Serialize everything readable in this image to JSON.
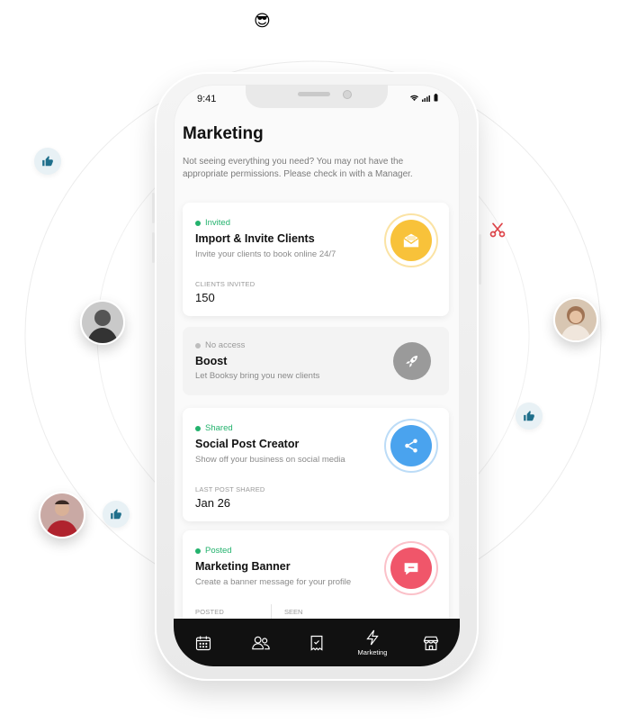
{
  "status_bar": {
    "time": "9:41"
  },
  "page": {
    "title": "Marketing",
    "subtitle": "Not seeing everything you need? You may not have the appropriate permissions. Please check in with a Manager."
  },
  "cards": [
    {
      "status": "Invited",
      "title": "Import & Invite Clients",
      "description": "Invite your clients to book online 24/7",
      "metric_label": "CLIENTS INVITED",
      "metric_value": "150",
      "icon": "envelope-icon",
      "color": "#f8c23a"
    },
    {
      "status": "No access",
      "title": "Boost",
      "description": "Let Booksy bring you new clients",
      "icon": "rocket-icon",
      "color": "#9a9a9a"
    },
    {
      "status": "Shared",
      "title": "Social Post Creator",
      "description": "Show off your business on social media",
      "metric_label": "LAST POST SHARED",
      "metric_value": "Jan 26",
      "icon": "share-icon",
      "color": "#4aa3ee"
    },
    {
      "status": "Posted",
      "title": "Marketing Banner",
      "description": "Create a banner message for your profile",
      "metric_label": "POSTED",
      "metric_label_2": "SEEN",
      "icon": "speech-bubble-icon",
      "color": "#f0566a"
    }
  ],
  "nav": {
    "items": [
      {
        "icon": "calendar-icon"
      },
      {
        "icon": "clients-icon"
      },
      {
        "icon": "receipt-icon"
      },
      {
        "icon": "lightning-icon",
        "label": "Marketing",
        "active": true
      },
      {
        "icon": "store-icon"
      }
    ]
  },
  "decorations": {
    "emoji": "😎",
    "like_icon": "thumbs-up-icon",
    "scissors_icon": "scissors-icon"
  },
  "colors": {
    "status_green": "#23b26d",
    "nav_background": "#111111",
    "like_badge": "#e8f1f5",
    "like_icon": "#1f6f8b"
  }
}
